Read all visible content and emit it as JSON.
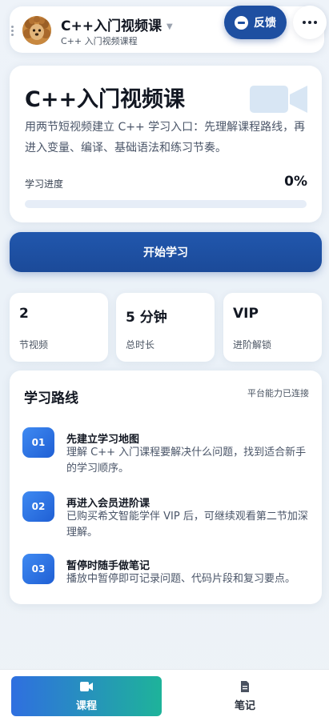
{
  "header": {
    "title": "C++入门视频课",
    "subtitle": "C++ 入门视频课程",
    "feedback_label": "反馈"
  },
  "hero": {
    "title": "C++入门视频课",
    "description": "用两节短视频建立 C++ 学习入口：先理解课程路线，再进入变量、编译、基础语法和练习节奏。",
    "progress_label": "学习进度",
    "progress_value": "0%",
    "progress_fraction": 0
  },
  "start_button": {
    "label": "开始学习"
  },
  "stats": [
    {
      "value": "2",
      "label": "节视频"
    },
    {
      "value": "5 分钟",
      "label": "总时长"
    },
    {
      "value": "VIP",
      "label": "进阶解锁"
    }
  ],
  "route": {
    "title": "学习路线",
    "status": "平台能力已连接",
    "steps": [
      {
        "num": "01",
        "title": "先建立学习地图",
        "desc": "理解 C++ 入门课程要解决什么问题，找到适合新手的学习顺序。"
      },
      {
        "num": "02",
        "title": "再进入会员进阶课",
        "desc": "已购买希文智能学伴 VIP 后，可继续观看第二节加深理解。"
      },
      {
        "num": "03",
        "title": "暂停时随手做笔记",
        "desc": "播放中暂停即可记录问题、代码片段和复习要点。"
      }
    ]
  },
  "bottom_nav": {
    "items": [
      {
        "label": "课程",
        "icon": "video-icon",
        "active": true
      },
      {
        "label": "笔记",
        "icon": "note-icon",
        "active": false
      }
    ]
  },
  "colors": {
    "primary": "#1e4fa1",
    "step_badge": "#2f74e6",
    "nav_gradient_start": "#2f6fe0",
    "nav_gradient_end": "#1eb39a"
  }
}
